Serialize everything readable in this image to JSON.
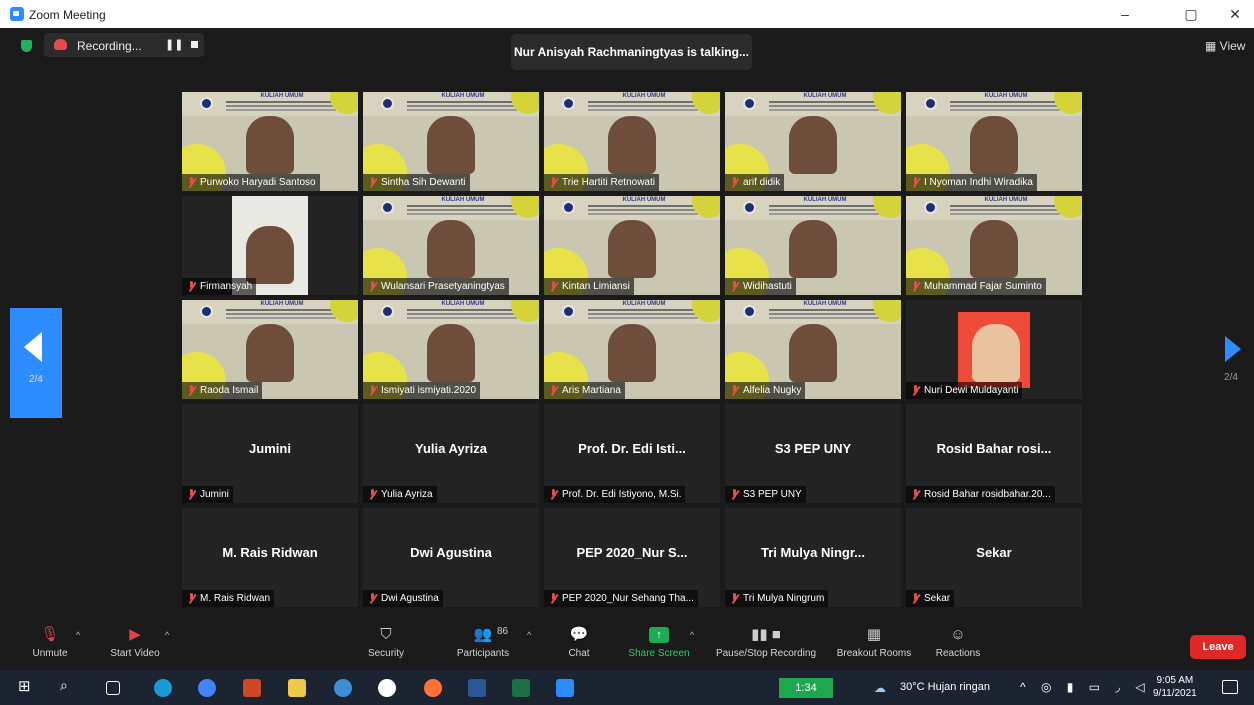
{
  "window": {
    "title": "Zoom Meeting",
    "controls": [
      "–",
      "▢",
      "✕"
    ]
  },
  "top_bar": {
    "recording_label": "Recording...",
    "talking": "Nur Anisyah Rachmaningtyas is talking...",
    "view_label": "View"
  },
  "pager": {
    "left": "2/4",
    "right": "2/4"
  },
  "tiles": [
    {
      "name": "Purwoko Haryadi Santoso",
      "video": "bg"
    },
    {
      "name": "Sintha Sih Dewanti",
      "video": "bg"
    },
    {
      "name": "Trie Hartiti Retnowati",
      "video": "bg"
    },
    {
      "name": "arif didik",
      "video": "bg"
    },
    {
      "name": "I Nyoman Indhi Wiradika",
      "video": "bg"
    },
    {
      "name": "Firmansyah",
      "video": "phone"
    },
    {
      "name": "Wulansari Prasetyaningtyas",
      "video": "bg"
    },
    {
      "name": "Kintan Limiansi",
      "video": "bg"
    },
    {
      "name": "Widihastuti",
      "video": "bg"
    },
    {
      "name": "Muhammad Fajar Suminto",
      "video": "bg"
    },
    {
      "name": "Raoda Ismail",
      "video": "bg"
    },
    {
      "name": "Ismiyati ismiyati.2020",
      "video": "bg"
    },
    {
      "name": "Aris Martiana",
      "video": "bg"
    },
    {
      "name": "Alfelia Nugky",
      "video": "bg"
    },
    {
      "name": "Nuri Dewi Muldayanti",
      "video": "photo"
    },
    {
      "name": "Jumini",
      "display": "Jumini",
      "video": "off"
    },
    {
      "name": "Yulia Ayriza",
      "display": "Yulia Ayriza",
      "video": "off"
    },
    {
      "name": "Prof. Dr. Edi Istiyono, M.Si.",
      "display": "Prof. Dr. Edi Isti...",
      "video": "off"
    },
    {
      "name": "S3 PEP UNY",
      "display": "S3 PEP UNY",
      "video": "off"
    },
    {
      "name": "Rosid Bahar rosidbahar.20...",
      "display": "Rosid Bahar rosi...",
      "video": "off"
    },
    {
      "name": "M. Rais Ridwan",
      "display": "M. Rais Ridwan",
      "video": "off"
    },
    {
      "name": "Dwi Agustina",
      "display": "Dwi Agustina",
      "video": "off"
    },
    {
      "name": "PEP 2020_Nur Sehang Tha...",
      "display": "PEP 2020_Nur S...",
      "video": "off"
    },
    {
      "name": "Tri Mulya Ningrum",
      "display": "Tri Mulya Ningr...",
      "video": "off"
    },
    {
      "name": "Sekar",
      "display": "Sekar",
      "video": "off"
    }
  ],
  "slide": {
    "title": "KULIAH UMUM"
  },
  "toolbar": {
    "unmute": "Unmute",
    "start_video": "Start Video",
    "security": "Security",
    "participants": "Participants",
    "participant_count": "86",
    "chat": "Chat",
    "share_screen": "Share Screen",
    "pause_stop_recording": "Pause/Stop Recording",
    "breakout_rooms": "Breakout Rooms",
    "reactions": "Reactions",
    "leave": "Leave"
  },
  "taskbar": {
    "timer": "1:34",
    "weather": "30°C  Hujan ringan",
    "time": "9:05 AM",
    "date": "9/11/2021",
    "notifications": "2"
  },
  "colors": {
    "accent": "#2d8cff",
    "leave": "#e02828",
    "share": "#1faa55",
    "muted": "#e05050"
  }
}
